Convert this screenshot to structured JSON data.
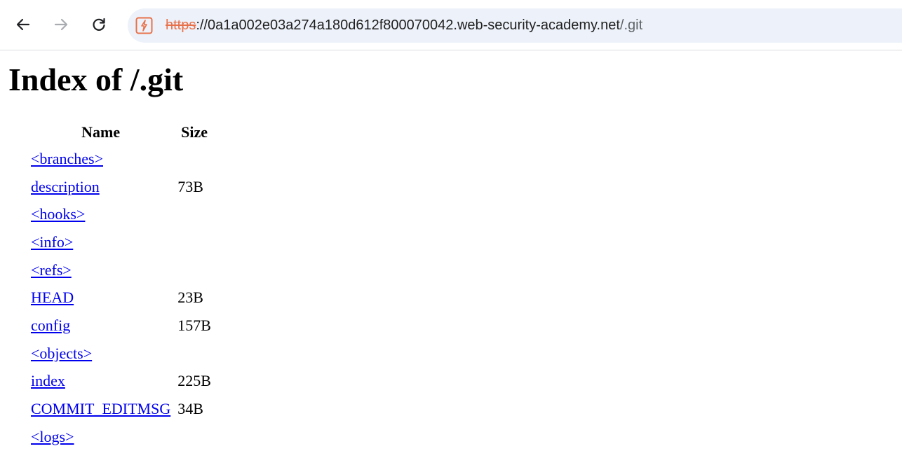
{
  "browser": {
    "url_scheme": "https",
    "url_host": "://0a1a002e03a274a180d612f800070042.web-security-academy.net",
    "url_path": "/.git",
    "accent_color": "#e8714a"
  },
  "page": {
    "title": "Index of /.git",
    "columns": [
      "Name",
      "Size"
    ],
    "rows": [
      {
        "name": "<branches>",
        "size": ""
      },
      {
        "name": "description",
        "size": "73B"
      },
      {
        "name": "<hooks>",
        "size": ""
      },
      {
        "name": "<info>",
        "size": ""
      },
      {
        "name": "<refs>",
        "size": ""
      },
      {
        "name": "HEAD",
        "size": "23B"
      },
      {
        "name": "config",
        "size": "157B"
      },
      {
        "name": "<objects>",
        "size": ""
      },
      {
        "name": "index",
        "size": "225B"
      },
      {
        "name": "COMMIT_EDITMSG",
        "size": "34B"
      },
      {
        "name": "<logs>",
        "size": ""
      }
    ]
  }
}
